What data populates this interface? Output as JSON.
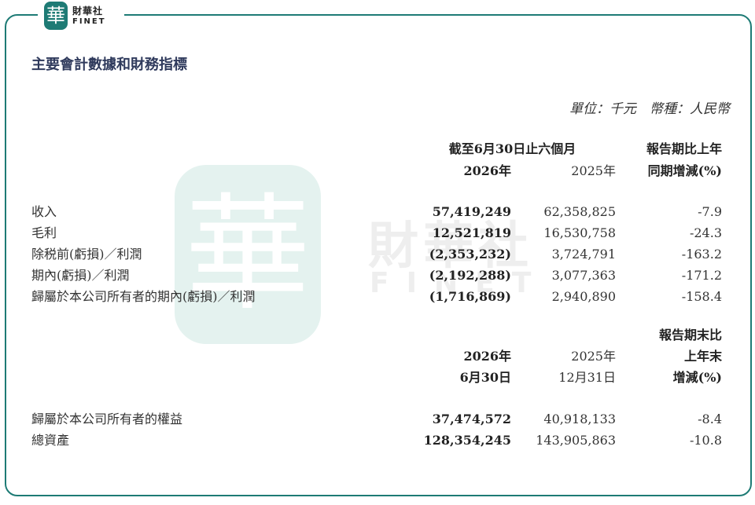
{
  "logo": {
    "seal": "華",
    "name_cn": "財華社",
    "name_en": "FINET"
  },
  "watermark": {
    "seal": "華",
    "name_cn": "財華社",
    "name_en": "FINET"
  },
  "title": "主要會計數據和財務指標",
  "unit": "單位：千元　幣種：人民幣",
  "income_header": {
    "period": "截至6月30日止六個月",
    "col_current": "2026年",
    "col_prior": "2025年",
    "change_line1": "報告期比上年",
    "change_line2": "同期增減(%)"
  },
  "income_rows": [
    {
      "label": "收入",
      "current": "57,419,249",
      "prior": "62,358,825",
      "change": "-7.9"
    },
    {
      "label": "毛利",
      "current": "12,521,819",
      "prior": "16,530,758",
      "change": "-24.3"
    },
    {
      "label": "除税前(虧損)／利潤",
      "current": "(2,353,232)",
      "prior": "3,724,791",
      "change": "-163.2"
    },
    {
      "label": "期內(虧損)／利潤",
      "current": "(2,192,288)",
      "prior": "3,077,363",
      "change": "-171.2"
    },
    {
      "label": "歸屬於本公司所有者的期內(虧損)／利潤",
      "current": "(1,716,869)",
      "prior": "2,940,890",
      "change": "-158.4"
    }
  ],
  "balance_header": {
    "current_year": "2026年",
    "current_date": "6月30日",
    "prior_year": "2025年",
    "prior_date": "12月31日",
    "change_line1": "報告期末比",
    "change_line2": "上年末",
    "change_line3": "增減(%)"
  },
  "balance_rows": [
    {
      "label": "歸屬於本公司所有者的權益",
      "current": "37,474,572",
      "prior": "40,918,133",
      "change": "-8.4"
    },
    {
      "label": "總資產",
      "current": "128,354,245",
      "prior": "143,905,863",
      "change": "-10.8"
    }
  ]
}
